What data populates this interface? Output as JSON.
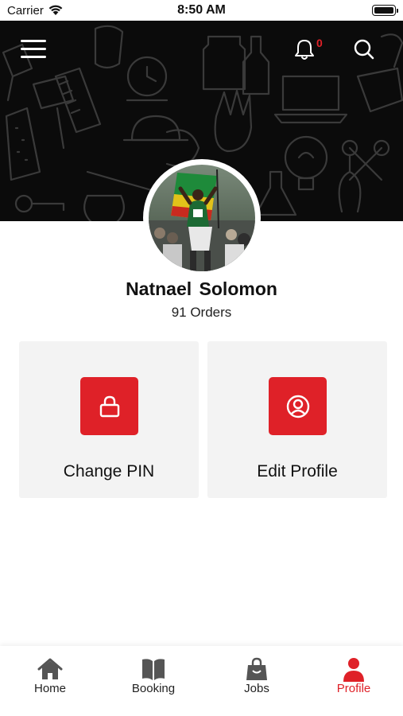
{
  "status_bar": {
    "carrier": "Carrier",
    "time": "8:50 AM"
  },
  "header": {
    "menu_icon": "hamburger-menu-icon",
    "bell_icon": "bell-icon",
    "notification_count": "0",
    "search_icon": "search-icon",
    "background_color": "#0b0b0b"
  },
  "profile": {
    "name": "Natnael  Solomon",
    "orders": "91 Orders"
  },
  "actions": [
    {
      "label": "Change PIN",
      "icon": "lock-icon"
    },
    {
      "label": "Edit Profile",
      "icon": "user-circle-icon"
    }
  ],
  "bottom_nav": [
    {
      "label": "Home",
      "icon": "home-icon",
      "active": false
    },
    {
      "label": "Booking",
      "icon": "book-icon",
      "active": false
    },
    {
      "label": "Jobs",
      "icon": "shopping-bag-icon",
      "active": false
    },
    {
      "label": "Profile",
      "icon": "person-icon",
      "active": true
    }
  ],
  "colors": {
    "accent": "#df2128",
    "card_background": "#f3f3f3",
    "text": "#111111"
  }
}
